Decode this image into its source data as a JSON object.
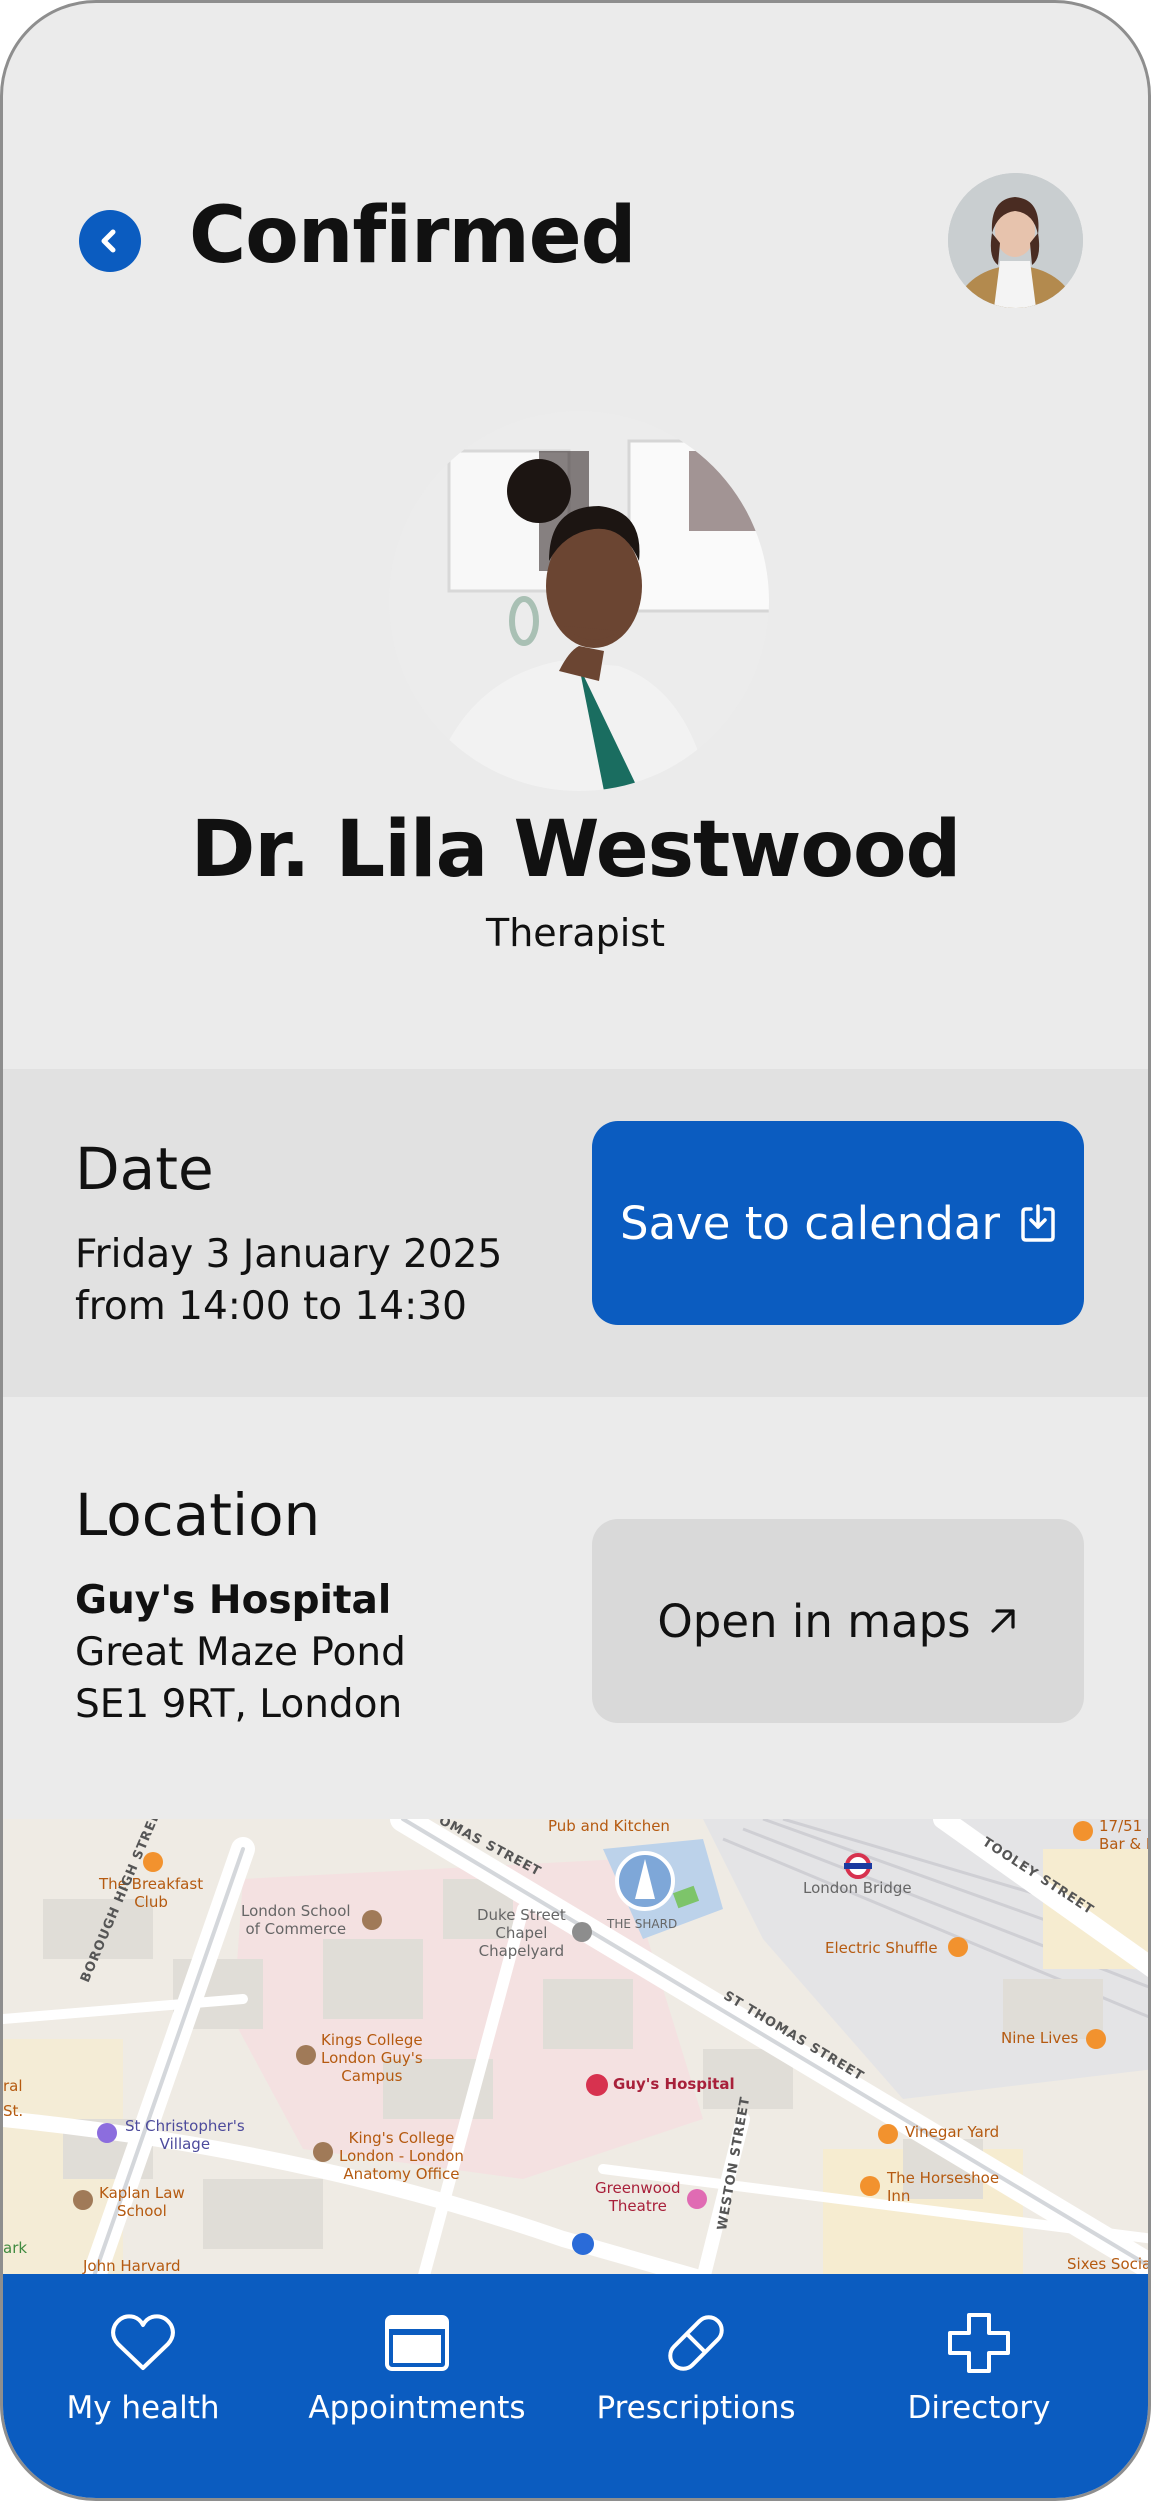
{
  "header": {
    "title": "Confirmed",
    "back_icon": "chevron-left-icon"
  },
  "doctor": {
    "name": "Dr. Lila Westwood",
    "role": "Therapist"
  },
  "date": {
    "heading": "Date",
    "line1": "Friday 3 January 2025",
    "line2": "from 14:00 to 14:30",
    "button_label": "Save to calendar",
    "button_icon": "calendar-download-icon"
  },
  "location": {
    "heading": "Location",
    "name": "Guy's Hospital",
    "address1": "Great Maze Pond",
    "address2": "SE1 9RT, London",
    "button_label": "Open in maps",
    "button_icon": "arrow-up-right-icon"
  },
  "map": {
    "labels": {
      "pub": "Pub and Kitchen",
      "breakfast": "The Breakfast\nClub",
      "lse": "London School\nof Commerce",
      "duke": "Duke Street\nChapel\nChapelyard",
      "shard": "THE SHARD",
      "london_bridge": "London Bridge",
      "electric": "Electric Shuffle",
      "bar": "17/51 D\nBar & K",
      "kings": "Kings College\nLondon Guy's\nCampus",
      "guys": "Guy's Hospital",
      "nine_lives": "Nine Lives",
      "stc": "St Christopher's\nVillage",
      "kings_anat": "King's College\nLondon - London\nAnatomy Office",
      "vinegar": "Vinegar Yard",
      "kaplan": "Kaplan Law\nSchool",
      "greenwood": "Greenwood\nTheatre",
      "horseshoe": "The Horseshoe\nInn",
      "harvard": "John Harvard",
      "sixes": "Sixes Socia",
      "ral": "ral",
      "st": "St.",
      "ark": "ark",
      "st_thomas_1": "ST THOMAS STREET",
      "st_thomas_2": "OMAS STREET",
      "tooley": "TOOLEY STREET",
      "borough": "BOROUGH HIGH STREET",
      "weston": "WESTON STREET"
    }
  },
  "nav": {
    "items": [
      {
        "label": "My health",
        "icon": "heart-icon"
      },
      {
        "label": "Appointments",
        "icon": "calendar-window-icon"
      },
      {
        "label": "Prescriptions",
        "icon": "pill-icon"
      },
      {
        "label": "Directory",
        "icon": "plus-cross-icon"
      }
    ]
  },
  "colors": {
    "primary": "#0b5cc0",
    "background": "#ebebeb",
    "section_alt": "#e1e1e1",
    "secondary_button": "#d9d9d9"
  }
}
